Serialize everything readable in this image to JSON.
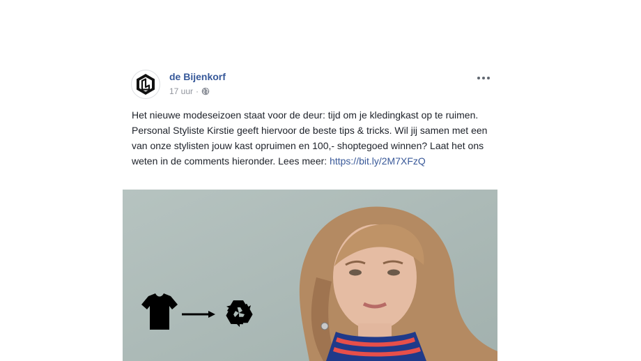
{
  "post": {
    "page_name": "de Bijenkorf",
    "timestamp": "17 uur",
    "separator": "·",
    "privacy_icon": "globe-icon",
    "more_icon": "more-horizontal-icon",
    "text": {
      "body": "Het nieuwe modeseizoen staat voor de deur: tijd om je kledingkast op te ruimen. Personal Styliste Kirstie geeft hiervoor de beste tips & tricks. Wil jij samen met een van onze stylisten jouw kast opruimen en 100,- shoptegoed winnen? Laat het ons weten in de comments hieronder.",
      "read_more_label": "Lees meer:",
      "link": "https://bit.ly/2M7XFzQ"
    },
    "media": {
      "icons": [
        "t-shirt-icon",
        "arrow-right-icon",
        "recycle-icon"
      ]
    }
  }
}
